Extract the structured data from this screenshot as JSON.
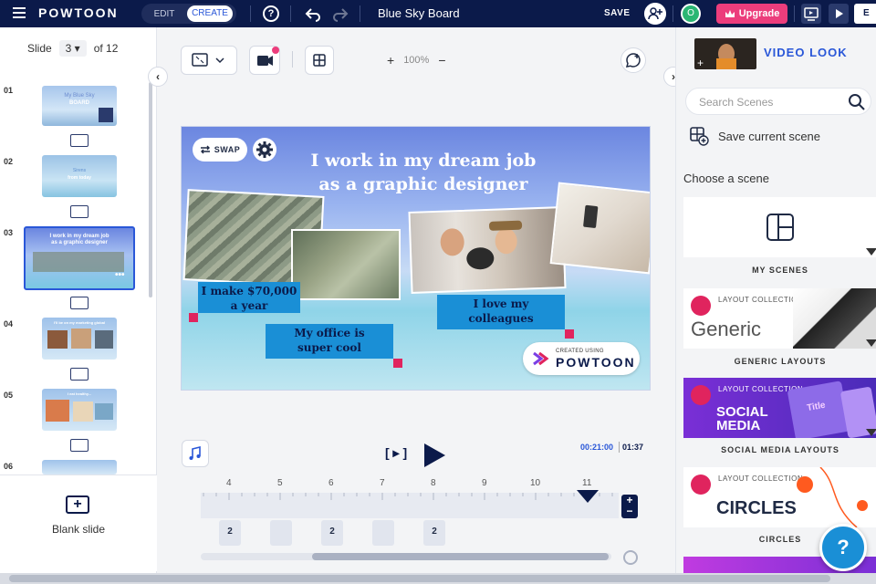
{
  "topbar": {
    "logo": "POWTOON",
    "mode_edit": "EDIT",
    "mode_create": "CREATE",
    "help": "?",
    "title": "Blue Sky Board",
    "save": "SAVE",
    "avatar_initial": "O",
    "upgrade": "Upgrade",
    "export_partial": "E"
  },
  "left": {
    "slide_label": "Slide",
    "current_slide": "3",
    "of_total": "of 12",
    "thumbs": [
      {
        "num": "01",
        "line1": "My Blue Sky",
        "line2": "BOARD"
      },
      {
        "num": "02",
        "line1": "Sirens",
        "line2": "from today"
      },
      {
        "num": "03",
        "line1": "I work in my dream job",
        "line2": "as a graphic designer"
      },
      {
        "num": "04",
        "line1": "I'll be on my marketing global",
        "line2": ""
      },
      {
        "num": "05",
        "line1": "I eat healthy...",
        "line2": ""
      },
      {
        "num": "06",
        "line1": "",
        "line2": ""
      }
    ],
    "blank_slide": "Blank slide"
  },
  "center": {
    "zoom_level": "100%",
    "canvas": {
      "headline_1": "I work in my dream job",
      "headline_2": "as a graphic designer",
      "swap": "SWAP",
      "callout_salary_1": "I make $70,000",
      "callout_salary_2": "a year",
      "callout_office_1": "My office is",
      "callout_office_2": "super cool",
      "callout_colleagues_1": "I love my",
      "callout_colleagues_2": "colleagues",
      "watermark_small": "CREATED USING",
      "watermark_big": "POWTOON"
    },
    "timeline": {
      "current_time": "00:21:00",
      "total_time": "01:37",
      "ticks": [
        "4",
        "5",
        "6",
        "7",
        "8",
        "9",
        "10",
        "11"
      ],
      "items": [
        "2",
        "",
        "2",
        "",
        "2"
      ]
    }
  },
  "right": {
    "video_look": "VIDEO LOOK",
    "search_placeholder": "Search Scenes",
    "save_scene": "Save current scene",
    "choose_scene": "Choose a scene",
    "scenes": [
      {
        "label": "MY SCENES"
      },
      {
        "label": "GENERIC LAYOUTS",
        "small": "LAYOUT COLLECTION",
        "big": "Generic"
      },
      {
        "label": "SOCIAL MEDIA LAYOUTS",
        "small": "LAYOUT COLLECTION",
        "big": "SOCIAL MEDIA",
        "card_text": "Title"
      },
      {
        "label": "CIRCLES",
        "small": "LAYOUT COLLECTION",
        "big": "CIRCLES"
      }
    ],
    "help_fab": "?"
  },
  "colors": {
    "topbar_bg": "#0b1a4a",
    "accent_blue": "#2a57d8",
    "upgrade_pink": "#ec3d7c",
    "callout_blue": "#1a8fd6",
    "highlight_pink": "#e0245e"
  }
}
